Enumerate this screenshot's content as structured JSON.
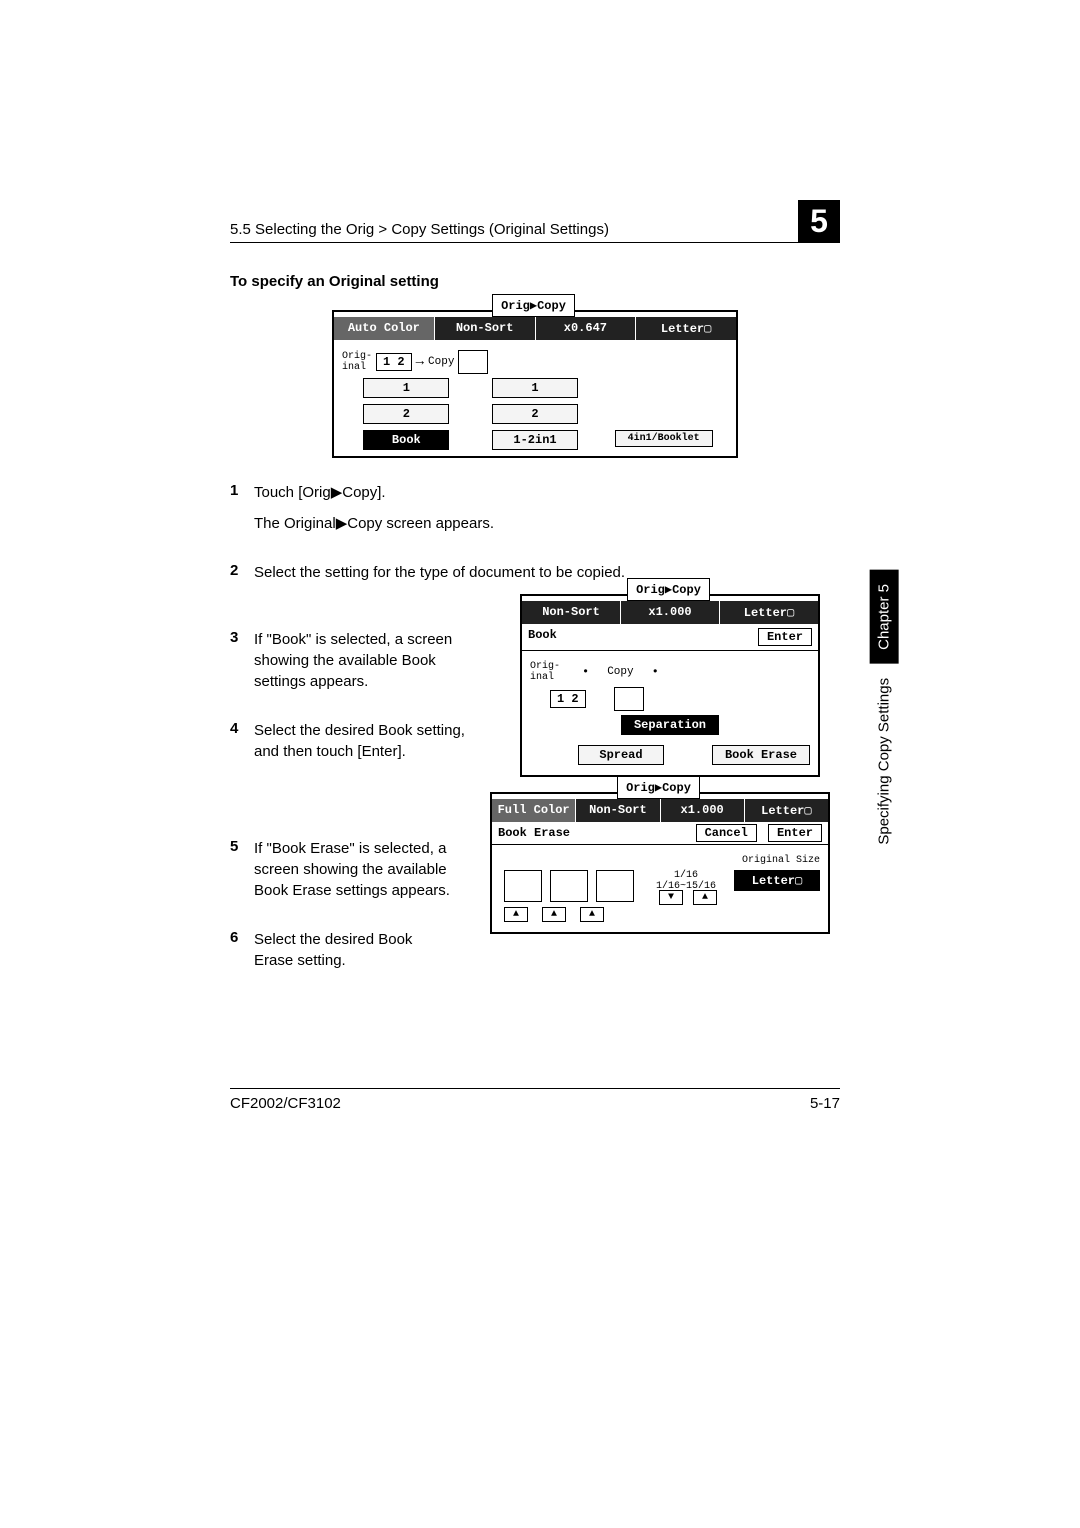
{
  "header": {
    "breadcrumb": "5.5 Selecting the Orig > Copy Settings (Original Settings)",
    "chapter": "5"
  },
  "section_title": "To specify an Original setting",
  "steps": {
    "s1": {
      "n": "1",
      "a": "Touch [Orig▶Copy].",
      "b": "The Original▶Copy screen appears."
    },
    "s2": {
      "n": "2",
      "a": "Select the setting for the type of document to be copied."
    },
    "s3": {
      "n": "3",
      "a": "If \"Book\" is selected, a screen showing the available Book settings appears."
    },
    "s4": {
      "n": "4",
      "a": "Select the desired Book setting, and then touch [Enter]."
    },
    "s5": {
      "n": "5",
      "a": "If \"Book Erase\" is selected, a screen showing the available Book Erase settings appears."
    },
    "s6": {
      "n": "6",
      "a": "Select the desired Book Erase setting."
    }
  },
  "screen1": {
    "tab": "Orig▶Copy",
    "c1": "Auto Color",
    "c2": "Non-Sort",
    "c3": "x0.647",
    "c4": "Letter▢",
    "orig": "Orig-inal",
    "copy": "Copy",
    "b1": "1",
    "b1r": "1",
    "b2": "2",
    "b2r": "2",
    "book": "Book",
    "twoin": "1-2in1",
    "booklet": "4in1/Booklet"
  },
  "screen2": {
    "tab": "Orig▶Copy",
    "c2": "Non-Sort",
    "c3": "x1.000",
    "c4": "Letter▢",
    "title": "Book",
    "enter": "Enter",
    "orig": "Orig-inal",
    "copy": "Copy",
    "sep": "Separation",
    "spread": "Spread",
    "erase": "Book Erase"
  },
  "screen3": {
    "tab": "Orig▶Copy",
    "c1": "Full Color",
    "c2": "Non-Sort",
    "c3": "x1.000",
    "c4": "Letter▢",
    "title": "Book Erase",
    "cancel": "Cancel",
    "enter": "Enter",
    "orig_size": "Original Size",
    "letter": "Letter▢",
    "frac": "1/16",
    "range": "1/16~15/16"
  },
  "side": {
    "text": "Specifying Copy Settings",
    "chapter": "Chapter 5"
  },
  "footer": {
    "model": "CF2002/CF3102",
    "page": "5-17"
  }
}
